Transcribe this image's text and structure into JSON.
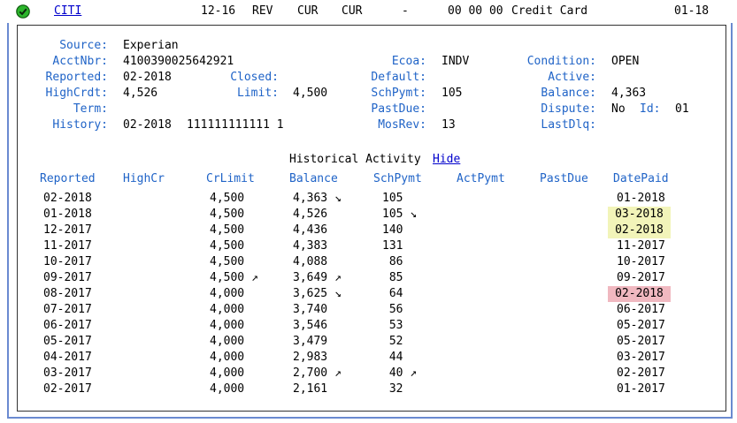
{
  "summary": {
    "creditor": "CITI",
    "opened": "12-16",
    "type": "REV",
    "status": "CUR",
    "status2": "CUR",
    "dash": "-",
    "codes": "00 00 00",
    "account_type": "Credit Card",
    "reported": "01-18"
  },
  "details": {
    "source_label": "Source:",
    "source": "Experian",
    "acctnbr_label": "AcctNbr:",
    "acctnbr": "4100390025642921",
    "reported_label": "Reported:",
    "reported": "02-2018",
    "closed_label": "Closed:",
    "closed": "",
    "highcrdt_label": "HighCrdt:",
    "highcrdt": "4,526",
    "limit_label": "Limit:",
    "limit": "4,500",
    "term_label": "Term:",
    "term": "",
    "history_label": "History:",
    "history_date": "02-2018",
    "history_code": "111111111111 1",
    "ecoa_label": "Ecoa:",
    "ecoa": "INDV",
    "default_label": "Default:",
    "default": "",
    "schpymt_label": "SchPymt:",
    "schpymt": "105",
    "pastdue_label": "PastDue:",
    "pastdue": "",
    "mosrev_label": "MosRev:",
    "mosrev": "13",
    "condition_label": "Condition:",
    "condition": "OPEN",
    "active_label": "Active:",
    "active": "",
    "balance_label": "Balance:",
    "balance": "4,363",
    "dispute_label": "Dispute:",
    "dispute": "No",
    "id_label": "Id:",
    "id": "01",
    "lastdlq_label": "LastDlq:",
    "lastdlq": ""
  },
  "history": {
    "title": "Historical Activity",
    "hide_link": "Hide",
    "columns": [
      "Reported",
      "HighCr",
      "CrLimit",
      "Balance",
      "SchPymt",
      "ActPymt",
      "PastDue",
      "DatePaid"
    ],
    "rows": [
      {
        "reported": "02-2018",
        "highcr": "",
        "crlimit": "4,500",
        "balance": "4,363 ↘",
        "schpymt": "105",
        "actpymt": "",
        "pastdue": "",
        "datepaid": "01-2018",
        "hl": ""
      },
      {
        "reported": "01-2018",
        "highcr": "",
        "crlimit": "4,500",
        "balance": "4,526",
        "schpymt": "105 ↘",
        "actpymt": "",
        "pastdue": "",
        "datepaid": "03-2018",
        "hl": "yellow"
      },
      {
        "reported": "12-2017",
        "highcr": "",
        "crlimit": "4,500",
        "balance": "4,436",
        "schpymt": "140",
        "actpymt": "",
        "pastdue": "",
        "datepaid": "02-2018",
        "hl": "yellow"
      },
      {
        "reported": "11-2017",
        "highcr": "",
        "crlimit": "4,500",
        "balance": "4,383",
        "schpymt": "131",
        "actpymt": "",
        "pastdue": "",
        "datepaid": "11-2017",
        "hl": ""
      },
      {
        "reported": "10-2017",
        "highcr": "",
        "crlimit": "4,500",
        "balance": "4,088",
        "schpymt": "86",
        "actpymt": "",
        "pastdue": "",
        "datepaid": "10-2017",
        "hl": ""
      },
      {
        "reported": "09-2017",
        "highcr": "",
        "crlimit": "4,500 ↗",
        "balance": "3,649 ↗",
        "schpymt": "85",
        "actpymt": "",
        "pastdue": "",
        "datepaid": "09-2017",
        "hl": ""
      },
      {
        "reported": "08-2017",
        "highcr": "",
        "crlimit": "4,000",
        "balance": "3,625 ↘",
        "schpymt": "64",
        "actpymt": "",
        "pastdue": "",
        "datepaid": "02-2018",
        "hl": "red"
      },
      {
        "reported": "07-2017",
        "highcr": "",
        "crlimit": "4,000",
        "balance": "3,740",
        "schpymt": "56",
        "actpymt": "",
        "pastdue": "",
        "datepaid": "06-2017",
        "hl": ""
      },
      {
        "reported": "06-2017",
        "highcr": "",
        "crlimit": "4,000",
        "balance": "3,546",
        "schpymt": "53",
        "actpymt": "",
        "pastdue": "",
        "datepaid": "05-2017",
        "hl": ""
      },
      {
        "reported": "05-2017",
        "highcr": "",
        "crlimit": "4,000",
        "balance": "3,479",
        "schpymt": "52",
        "actpymt": "",
        "pastdue": "",
        "datepaid": "05-2017",
        "hl": ""
      },
      {
        "reported": "04-2017",
        "highcr": "",
        "crlimit": "4,000",
        "balance": "2,983",
        "schpymt": "44",
        "actpymt": "",
        "pastdue": "",
        "datepaid": "03-2017",
        "hl": ""
      },
      {
        "reported": "03-2017",
        "highcr": "",
        "crlimit": "4,000",
        "balance": "2,700 ↗",
        "schpymt": "40 ↗",
        "actpymt": "",
        "pastdue": "",
        "datepaid": "02-2017",
        "hl": ""
      },
      {
        "reported": "02-2017",
        "highcr": "",
        "crlimit": "4,000",
        "balance": "2,161",
        "schpymt": "32",
        "actpymt": "",
        "pastdue": "",
        "datepaid": "01-2017",
        "hl": ""
      }
    ]
  },
  "colors": {
    "label": "#1f63c7",
    "link": "#0000cc",
    "highlight_yellow": "#f2f4b9",
    "highlight_red": "#f0b8c0",
    "check": "#2bb52b"
  },
  "icons": {
    "status": "check-circle-icon"
  }
}
